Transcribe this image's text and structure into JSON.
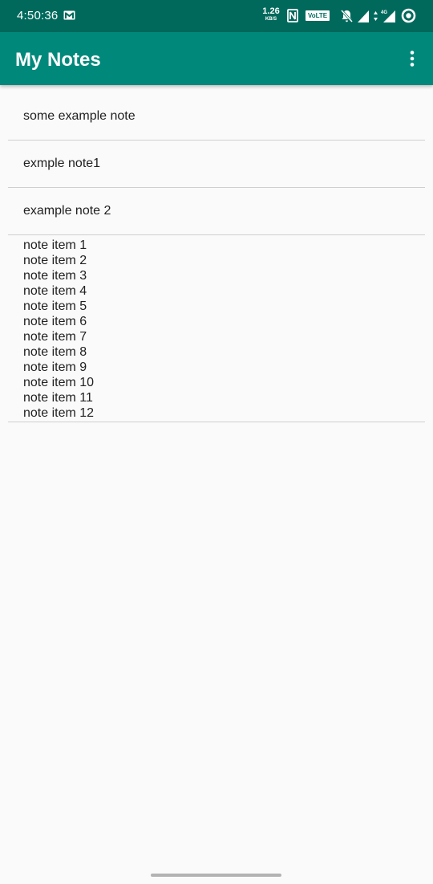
{
  "status_bar": {
    "time": "4:50:36",
    "net_speed_value": "1.26",
    "net_speed_unit": "KB/S",
    "volte_label": "VoLTE",
    "network_label": "4G",
    "icons": [
      "gmail-icon",
      "nfc-icon",
      "volte-badge",
      "bell-off-icon",
      "signal-icon",
      "data-arrows-icon",
      "signal-4g-icon",
      "sync-icon"
    ]
  },
  "app_bar": {
    "title": "My Notes",
    "overflow_icon": "more-vert-icon"
  },
  "notes": [
    {
      "text": "some example note"
    },
    {
      "text": "exmple note1"
    },
    {
      "text": "example note 2"
    }
  ],
  "multi_note": {
    "lines": [
      "note item 1",
      "note item 2",
      "note item 3",
      "note item 4",
      "note item 5",
      "note item 6",
      "note item 7",
      "note item 8",
      "note item 9",
      "note item 10",
      "note item 11",
      "note item 12"
    ]
  },
  "colors": {
    "status_bar": "#00695c",
    "app_bar": "#00897b",
    "background": "#fafafa",
    "divider": "#cfcfcf",
    "text": "#212121"
  }
}
